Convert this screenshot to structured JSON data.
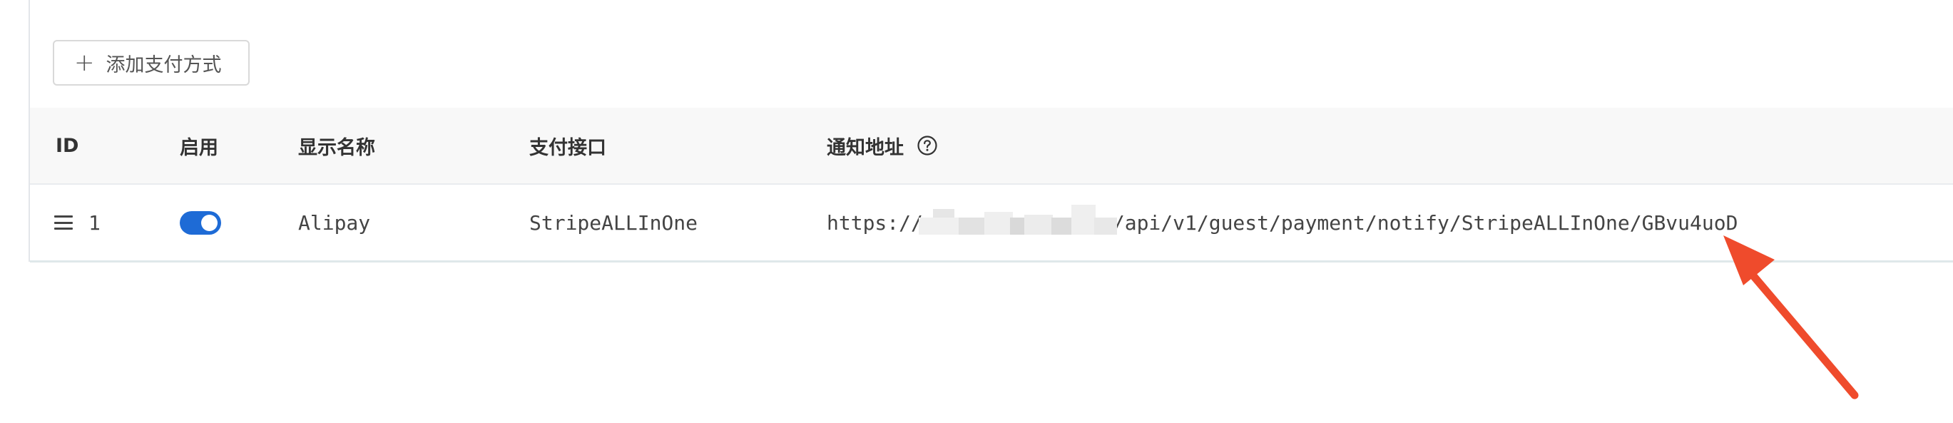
{
  "toolbar": {
    "add_label": "添加支付方式",
    "add_icon": "plus-icon"
  },
  "table": {
    "columns": [
      "ID",
      "启用",
      "显示名称",
      "支付接口",
      "通知地址"
    ],
    "notify_help_icon": "question-circle-icon",
    "rows": [
      {
        "id": "1",
        "enabled": true,
        "display_name": "Alipay",
        "interface": "StripeALLInOne",
        "notify_url_prefix": "https://",
        "notify_url_suffix": "/api/v1/guest/payment/notify/StripeALLInOne/GBvu4uoD"
      }
    ]
  },
  "colors": {
    "toggle_on": "#1e6bd6",
    "header_bg": "#f8f8f8",
    "annotation_arrow": "#ef4b2c"
  }
}
